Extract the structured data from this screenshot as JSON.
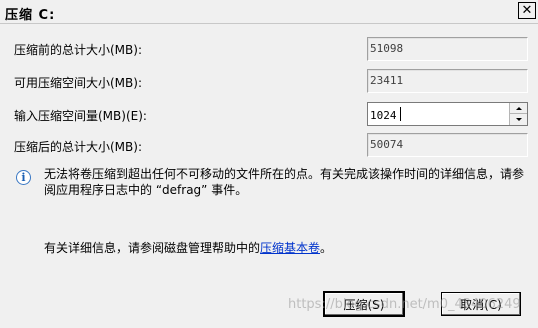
{
  "window": {
    "title": "压缩 C:",
    "close_glyph": "✕"
  },
  "rows": [
    {
      "label": "压缩前的总计大小(MB):",
      "value": "51098"
    },
    {
      "label": "可用压缩空间大小(MB):",
      "value": "23411"
    },
    {
      "label": "输入压缩空间量(MB)(E):",
      "value": "1024"
    },
    {
      "label": "压缩后的总计大小(MB):",
      "value": "50074"
    }
  ],
  "info": {
    "icon": "info-icon",
    "text": "无法将卷压缩到超出任何不可移动的文件所在的点。有关完成该操作时间的详细信息，请参阅应用程序日志中的 “defrag” 事件。"
  },
  "more_info": {
    "prefix": "有关详细信息，请参阅磁盘管理帮助中的",
    "link": "压缩基本卷",
    "suffix": "。"
  },
  "buttons": {
    "shrink": "压缩(S)",
    "cancel": "取消(C)"
  },
  "watermark": "https://blog.csdn.net/m0_43406249"
}
